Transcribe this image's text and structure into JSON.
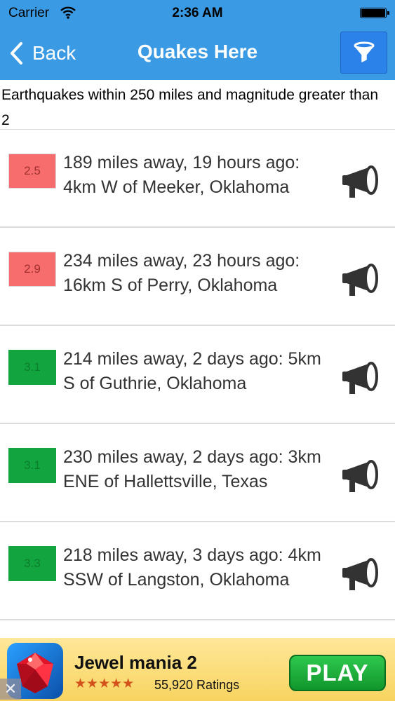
{
  "status": {
    "carrier": "Carrier",
    "time": "2:36 AM"
  },
  "navbar": {
    "back_label": "Back",
    "title": "Quakes Here",
    "filter_icon": "filter-funnel-icon"
  },
  "header": {
    "text": "Earthquakes within 250 miles and magnitude greater than 2"
  },
  "quakes": [
    {
      "magnitude": "2.5",
      "severity_color": "#f76c6c",
      "description": "189 miles away, 19 hours ago: 4km W of Meeker, Oklahoma"
    },
    {
      "magnitude": "2.9",
      "severity_color": "#f76c6c",
      "description": "234 miles away, 23 hours ago: 16km S of Perry, Oklahoma"
    },
    {
      "magnitude": "3.1",
      "severity_color": "#12a53f",
      "description": "214 miles away, 2 days ago: 5km S of Guthrie, Oklahoma"
    },
    {
      "magnitude": "3.1",
      "severity_color": "#12a53f",
      "description": "230 miles away, 2 days ago: 3km ENE of Hallettsville, Texas"
    },
    {
      "magnitude": "3.3",
      "severity_color": "#12a53f",
      "description": "218 miles away, 3 days ago: 4km SSW of Langston, Oklahoma"
    }
  ],
  "ad": {
    "title": "Jewel mania 2",
    "stars": "★★★★★",
    "rating": 4.5,
    "ratings_count": "55,920 Ratings",
    "play_label": "PLAY",
    "close_glyph": "✕"
  },
  "colors": {
    "navbar": "#3a9ae3",
    "filter_button": "#2b82e8",
    "ad_background": "#f7d460",
    "play_button": "#11962c"
  }
}
